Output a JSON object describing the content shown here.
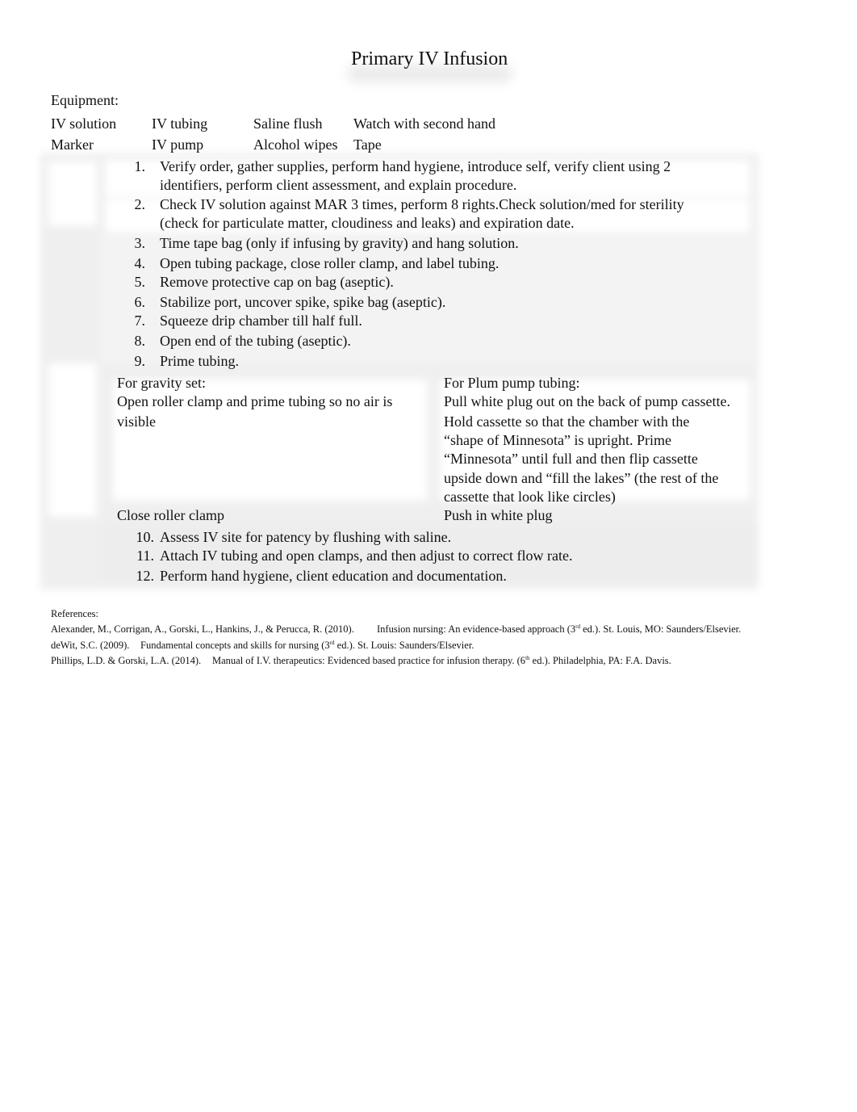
{
  "document": {
    "title": "Primary IV Infusion",
    "equipment": {
      "heading": "Equipment:",
      "rows": [
        [
          "IV solution",
          "IV tubing",
          "Saline flush",
          "Watch with second hand"
        ],
        [
          "Marker",
          "IV pump",
          "Alcohol wipes",
          "Tape"
        ]
      ]
    },
    "steps_part1": [
      {
        "num": "1.",
        "lines": [
          "Verify order, gather supplies, perform hand hygiene, introduce self, verify client using 2",
          "identifiers, perform client assessment, and explain procedure."
        ]
      },
      {
        "num": "2.",
        "lines": [
          "Check IV solution against MAR 3 times, perform 8 rights.Check solution/med for sterility",
          "(check for particulate matter, cloudiness and leaks) and expiration date."
        ]
      },
      {
        "num": "3.",
        "lines": [
          "Time tape bag (only if infusing by gravity) and hang solution."
        ]
      },
      {
        "num": "4.",
        "lines": [
          "Open tubing package, close roller clamp, and label tubing."
        ]
      },
      {
        "num": "5.",
        "lines": [
          "Remove protective cap on bag (aseptic)."
        ]
      },
      {
        "num": "6.",
        "lines": [
          "Stabilize port, uncover spike, spike bag (aseptic)."
        ]
      },
      {
        "num": "7.",
        "lines": [
          "Squeeze drip chamber till half full."
        ]
      },
      {
        "num": "8.",
        "lines": [
          "Open end of the tubing (aseptic)."
        ]
      },
      {
        "num": "9.",
        "lines": [
          "Prime tubing."
        ]
      }
    ],
    "priming_table": {
      "gravity": {
        "heading": "For gravity set:",
        "lines": [
          "Open roller clamp and prime tubing so no air is",
          "visible"
        ],
        "final": "Close roller clamp"
      },
      "pump": {
        "heading": "For Plum pump tubing:",
        "lines": [
          "Pull white plug out on the back of pump cassette.",
          "Hold cassette so that the chamber with the",
          "“shape of Minnesota” is upright.   Prime",
          "“Minnesota” until full and then flip cassette",
          "upside down and “fill the lakes” (the rest of the",
          "cassette that look like circles)"
        ],
        "final": "Push in white plug"
      }
    },
    "steps_part2": [
      {
        "num": "10.",
        "lines": [
          "Assess IV site for patency by flushing with saline."
        ]
      },
      {
        "num": "11.",
        "lines": [
          "Attach IV tubing and open clamps, and then adjust to correct flow rate."
        ]
      },
      {
        "num": "12.",
        "lines": [
          "Perform hand hygiene, client education and documentation."
        ]
      }
    ],
    "references": {
      "heading": "References:",
      "items": [
        {
          "authors": "Alexander, M., Corrigan, A., Gorski, L., Hankins, J., & Perucca, R. (2010).",
          "title": "Infusion nursing: An evidence-based approach (3",
          "sup": "rd",
          "rest": " ed.).  St. Louis, MO: Saunders/Elsevier."
        },
        {
          "authors": "deWit, S.C. (2009).",
          "title": "Fundamental concepts and skills for nursing (3",
          "sup": "rd",
          "rest": " ed.).  St. Louis: Saunders/Elsevier."
        },
        {
          "authors": "Phillips, L.D. & Gorski, L.A. (2014).",
          "title": "Manual of I.V. therapeutics: Evidenced based practice for infusion therapy. (6",
          "sup": "th",
          "rest": " ed.). Philadelphia, PA: F.A. Davis."
        }
      ]
    }
  }
}
